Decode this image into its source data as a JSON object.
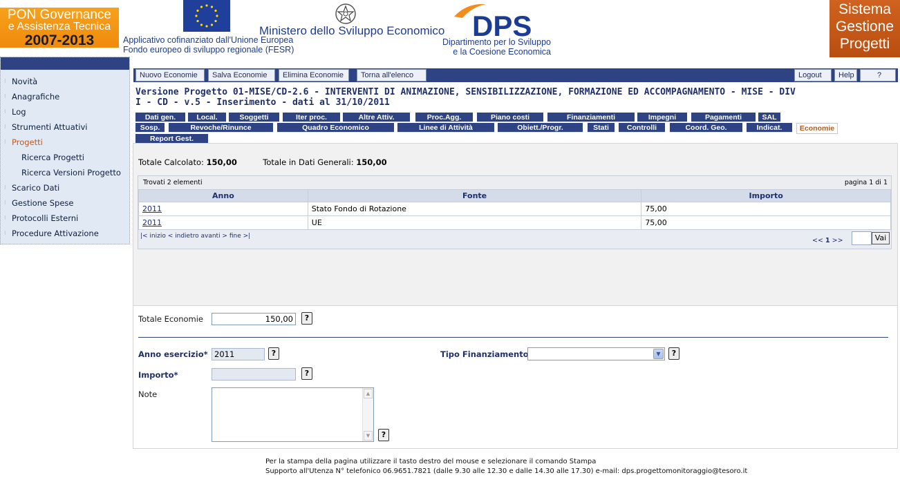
{
  "header": {
    "pon_logo": [
      "PON Governance",
      "e Assistenza Tecnica",
      "2007-2013"
    ],
    "cofinanced_text": [
      "Applicativo cofinanziato dall'Unione Europea",
      "Fondo europeo di sviluppo regionale (FESR)"
    ],
    "ministry": "Ministero dello Sviluppo Economico",
    "dps_logo": "DPS",
    "dps_text": [
      "Dipartimento per lo Sviluppo",
      "e la Coesione Economica"
    ],
    "sgp_logo": [
      "Sistema",
      "Gestione",
      "Progetti"
    ],
    "colors": {
      "orange": "#f7a11a",
      "navy": "#2d4383",
      "dps_blue": "#1b3c94"
    }
  },
  "sidebar": {
    "items": [
      {
        "label": "Novità"
      },
      {
        "label": "Anagrafiche"
      },
      {
        "label": "Log"
      },
      {
        "label": "Strumenti Attuativi"
      },
      {
        "label": "Progetti",
        "active": true
      },
      {
        "label": "Ricerca Progetti",
        "sub": true
      },
      {
        "label": "Ricerca Versioni Progetto",
        "sub": true
      },
      {
        "label": "Scarico Dati"
      },
      {
        "label": "Gestione Spese"
      },
      {
        "label": "Protocolli Esterni"
      },
      {
        "label": "Procedure Attivazione"
      }
    ]
  },
  "toolbar": {
    "nuovo": "Nuovo Economie",
    "salva": "Salva Economie",
    "elimina": "Elimina Economie",
    "torna": "Torna all'elenco",
    "logout": "Logout",
    "help": "Help",
    "question": "?"
  },
  "title": {
    "line1": "Versione Progetto  01-MISE/CD-2.6 - INTERVENTI DI ANIMAZIONE, SENSIBILIZZAZIONE, FORMAZIONE ED ACCOMPAGNAMENTO - MISE - DIV",
    "line2": "I - CD -  v.5 -  Inserimento -  dati al 31/10/2011"
  },
  "tabs": {
    "dati_gen": "Dati gen.",
    "local": "Local.",
    "soggetti": "Soggetti",
    "iter_proc": "Iter proc.",
    "altre_attiv": "Altre Attiv.",
    "proc_agg": "Proc.Agg.",
    "piano_costi": "Piano costi",
    "finanziamenti": "Finanziamenti",
    "impegni": "Impegni",
    "pagamenti": "Pagamenti",
    "sal": "SAL",
    "sosp": "Sosp.",
    "revoche": "Revoche/Rinunce",
    "quadro": "Quadro Economico",
    "linee": "Linee di Attività",
    "obiett": "Obiett./Progr.",
    "stati": "Stati",
    "controlli": "Controlli",
    "coord": "Coord. Geo.",
    "indicat": "Indicat.",
    "economie": "Economie",
    "report": "Report Gest."
  },
  "totals": {
    "calcolato_label": "Totale Calcolato:",
    "calcolato_value": "150,00",
    "dati_generali_label": "Totale in Dati Generali:",
    "dati_generali_value": "150,00"
  },
  "grid": {
    "found": "Trovati 2 elementi",
    "page_info": "pagina 1 di 1",
    "columns": [
      "Anno",
      "Fonte",
      "Importo"
    ],
    "rows": [
      {
        "anno": "2011",
        "fonte": "Stato Fondo di Rotazione",
        "importo": "75,00"
      },
      {
        "anno": "2011",
        "fonte": "UE",
        "importo": "75,00"
      }
    ],
    "nav": "|< inizio < indietro avanti > fine >|",
    "pager_prev": "<<",
    "pager_page": "1",
    "pager_next": ">>",
    "vai": "Vai"
  },
  "form": {
    "totale_economie_label": "Totale Economie",
    "totale_economie_value": "150,00",
    "anno_label": "Anno esercizio*",
    "anno_value": "2011",
    "tipo_label": "Tipo Finanziamento",
    "importo_label": "Importo*",
    "note_label": "Note",
    "help": "?"
  },
  "footer": {
    "line1": "Per la stampa della pagina utilizzare il tasto destro del mouse e selezionare il comando Stampa",
    "line2": "Supporto all'Utenza N° telefonico 06.9651.7821 (dalle 9.30 alle 12.30 e dalle 14.30 alle 17.30) e-mail: dps.progettomonitoraggio@tesoro.it"
  }
}
